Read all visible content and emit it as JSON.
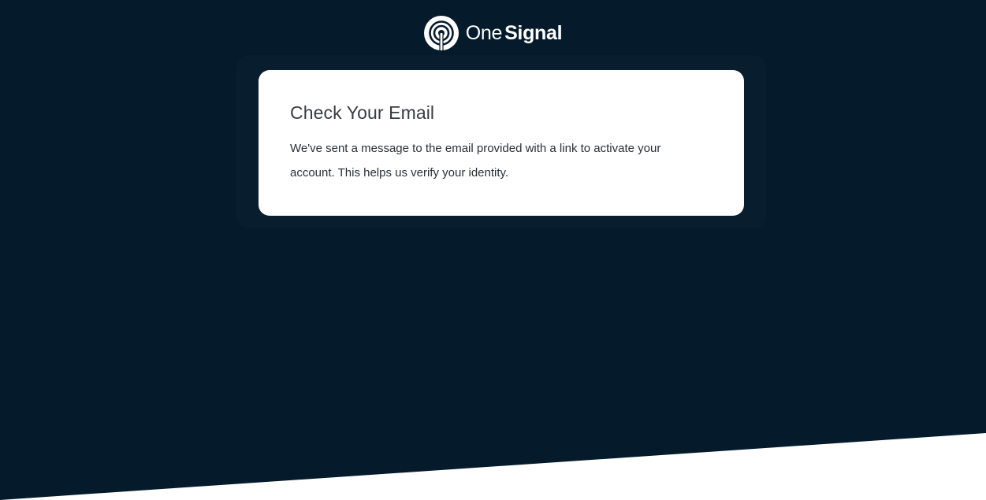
{
  "brand": {
    "name_part1": "One",
    "name_part2": "Signal",
    "logo_icon": "broadcast-signal-icon"
  },
  "card": {
    "title": "Check Your Email",
    "message": "We've sent a message to the email provided with a link to activate your account. This helps us verify your identity."
  },
  "colors": {
    "background": "#051b2c",
    "card": "#ffffff",
    "title_text": "#3a3c40",
    "body_text": "#2b2f36",
    "slant": "#ffffff"
  }
}
